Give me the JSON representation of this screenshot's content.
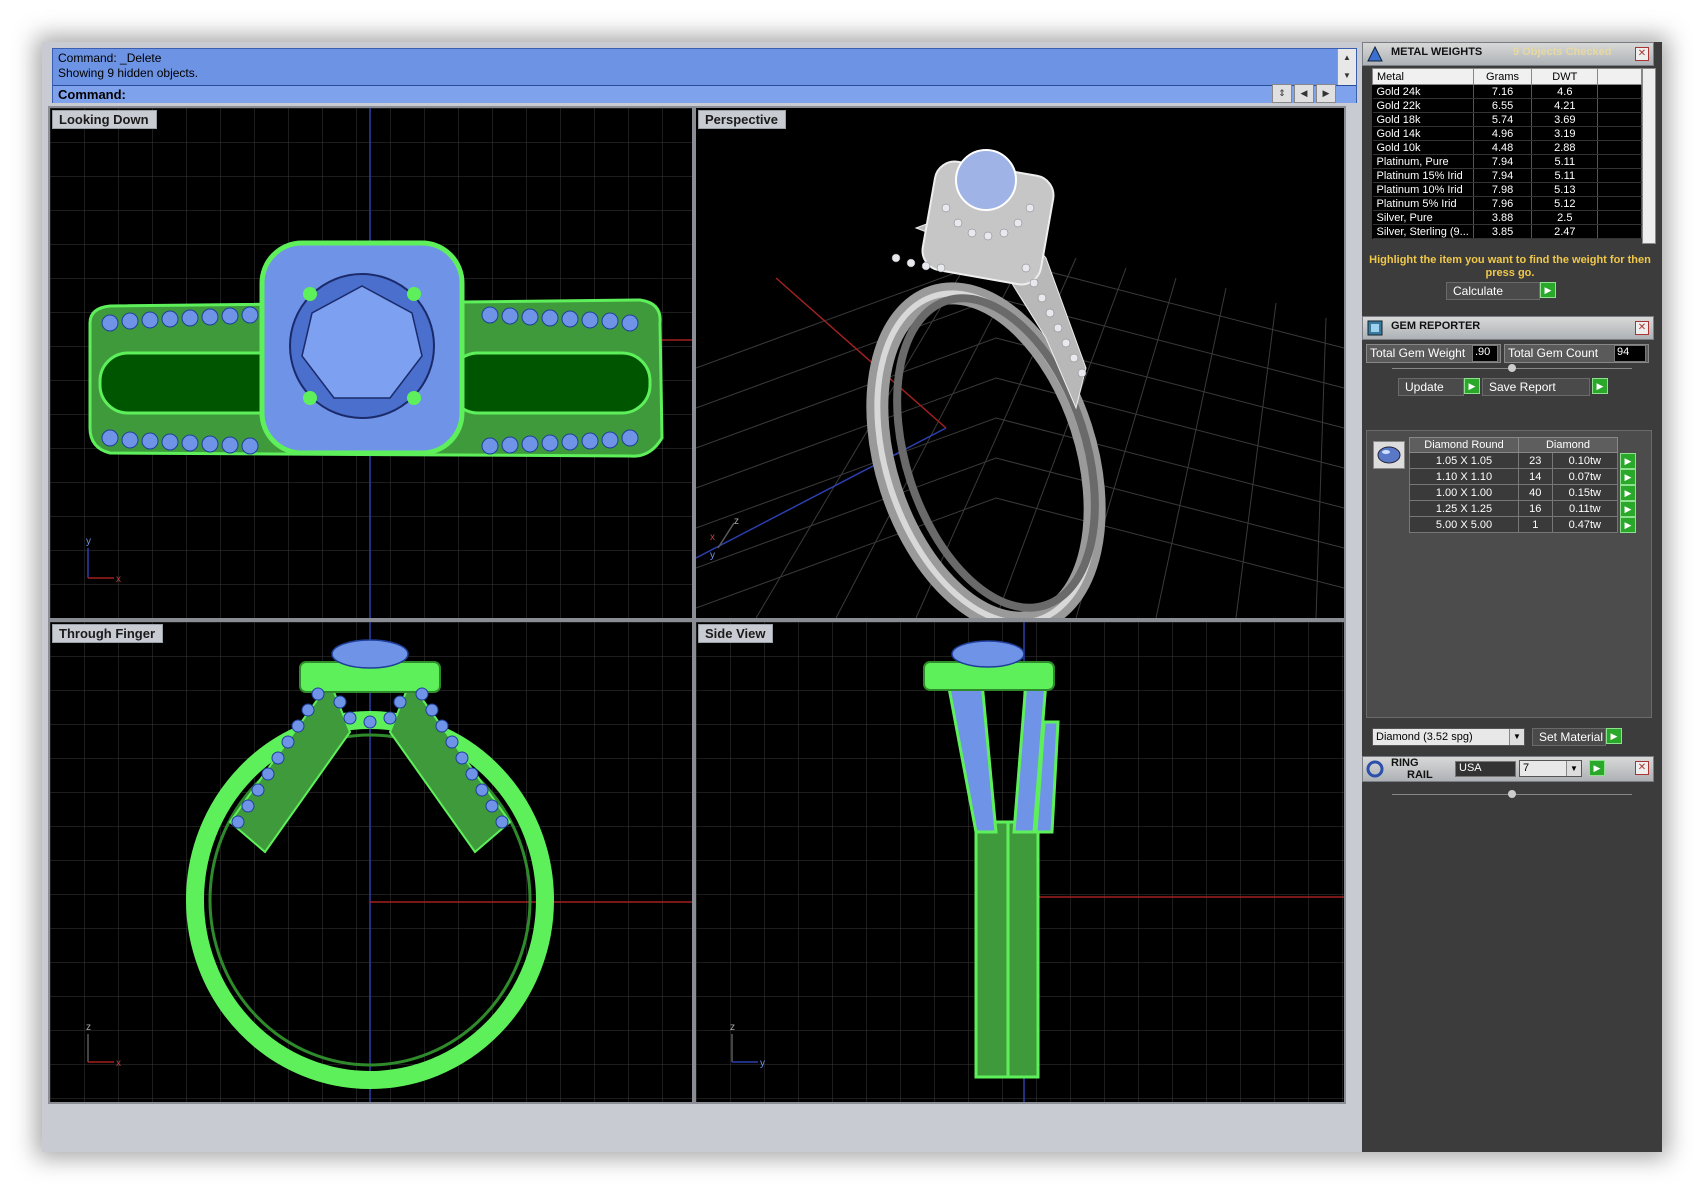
{
  "command": {
    "line1": "Command: _Delete",
    "line2": "Showing 9 hidden objects.",
    "prompt": "Command:"
  },
  "viewports": [
    {
      "label": "Looking Down"
    },
    {
      "label": "Perspective"
    },
    {
      "label": "Through Finger"
    },
    {
      "label": "Side View"
    }
  ],
  "axes": {
    "x": "x",
    "y": "y",
    "z": "z"
  },
  "metal_weights": {
    "title": "METAL WEIGHTS",
    "status": "9 Objects Checked",
    "columns": [
      "Metal",
      "Grams",
      "DWT"
    ],
    "rows": [
      [
        "Gold 24k",
        "7.16",
        "4.6"
      ],
      [
        "Gold 22k",
        "6.55",
        "4.21"
      ],
      [
        "Gold 18k",
        "5.74",
        "3.69"
      ],
      [
        "Gold 14k",
        "4.96",
        "3.19"
      ],
      [
        "Gold 10k",
        "4.48",
        "2.88"
      ],
      [
        "Platinum, Pure",
        "7.94",
        "5.11"
      ],
      [
        "Platinum 15% Irid",
        "7.94",
        "5.11"
      ],
      [
        "Platinum 10% Irid",
        "7.98",
        "5.13"
      ],
      [
        "Platinum 5% Irid",
        "7.96",
        "5.12"
      ],
      [
        "Silver, Pure",
        "3.88",
        "2.5"
      ],
      [
        "Silver, Sterling (9...",
        "3.85",
        "2.47"
      ]
    ],
    "hint": "Highlight the item you want to find the weight for then press go.",
    "calculate_label": "Calculate"
  },
  "gem_reporter": {
    "title": "GEM REPORTER",
    "total_weight_label": "Total Gem Weight",
    "total_weight_value": ".90",
    "total_count_label": "Total Gem Count",
    "total_count_value": "94",
    "update_label": "Update",
    "save_report_label": "Save Report",
    "table_headers": [
      "Diamond Round",
      "Diamond"
    ],
    "rows": [
      [
        "1.05 X 1.05",
        "23",
        "0.10tw"
      ],
      [
        "1.10 X 1.10",
        "14",
        "0.07tw"
      ],
      [
        "1.00 X 1.00",
        "40",
        "0.15tw"
      ],
      [
        "1.25 X 1.25",
        "16",
        "0.11tw"
      ],
      [
        "5.00 X 5.00",
        "1",
        "0.47tw"
      ]
    ],
    "material_value": "Diamond    (3.52 spg)",
    "set_material_label": "Set Material"
  },
  "ring_rail": {
    "title_line1": "RING",
    "title_line2": "RAIL",
    "region": "USA",
    "size": "7"
  },
  "colors": {
    "wire_green": "#5ef05a",
    "wire_blue": "#6f93e6",
    "grid": "#3a3a3a",
    "command_bg": "#6d93e4",
    "hint_text": "#f0c84a"
  }
}
